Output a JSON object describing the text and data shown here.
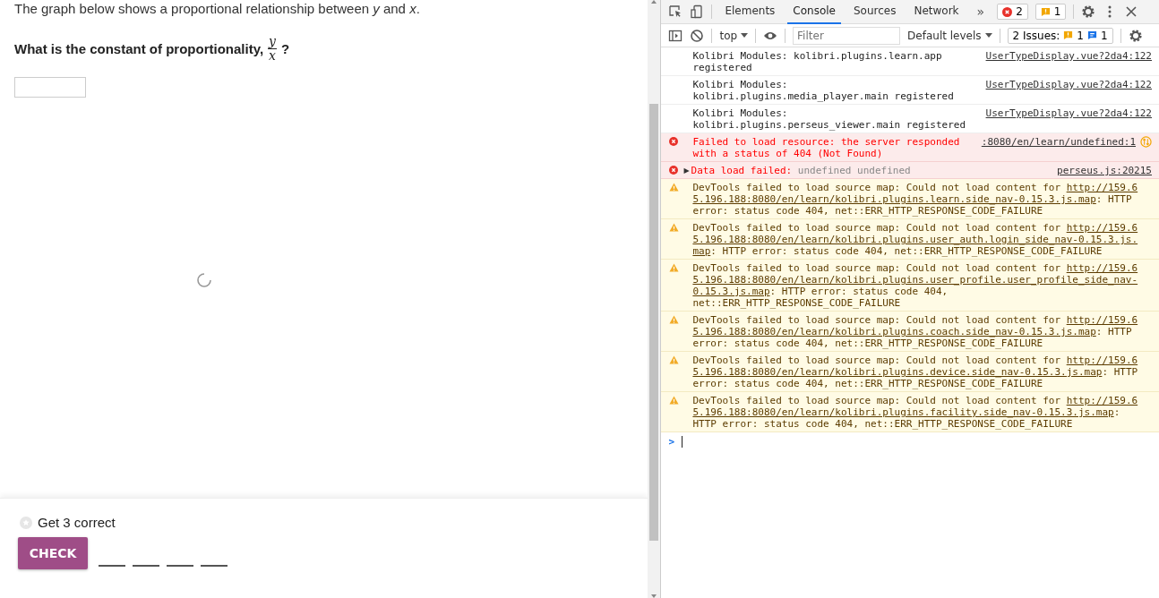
{
  "exercise": {
    "prompt": "The graph below shows a proportional relationship between *y* and *x*.",
    "question": {
      "text": "What is the constant of proportionality,",
      "numerator": "y",
      "denominator": "x",
      "end": "?"
    },
    "goal": "Get 3 correct",
    "check_button": "CHECK",
    "attempt_slots": [
      {
        "answered": false
      },
      {
        "answered": false
      },
      {
        "answered": false
      },
      {
        "answered": false
      }
    ]
  },
  "devtools": {
    "tabs": [
      {
        "label": "Elements",
        "selected": false
      },
      {
        "label": "Console",
        "selected": true
      },
      {
        "label": "Sources",
        "selected": false
      },
      {
        "label": "Network",
        "selected": false
      }
    ],
    "more_tabs": "»",
    "error_count": "2",
    "warning_count": "1",
    "context": "top",
    "filter": {
      "placeholder": "Filter"
    },
    "levels": "Default levels",
    "issues": {
      "label": "2 Issues:",
      "warnings": "1",
      "infos": "1"
    },
    "messages": [
      {
        "kind": "info",
        "text": "Kolibri Modules: kolibri.plugins.learn.app registered",
        "source": "UserTypeDisplay.vue?2da4:122",
        "network_icon": false
      },
      {
        "kind": "info",
        "text": "Kolibri Modules: kolibri.plugins.media_player.main registered",
        "source": "UserTypeDisplay.vue?2da4:122",
        "network_icon": false
      },
      {
        "kind": "info",
        "text": "Kolibri Modules: kolibri.plugins.perseus_viewer.main registered",
        "source": "UserTypeDisplay.vue?2da4:122",
        "network_icon": false
      },
      {
        "kind": "error",
        "text": "Failed to load resource: the server responded with a status of 404 (Not Found)",
        "source": ":8080/en/learn/undefined:1",
        "network_icon": true
      },
      {
        "kind": "error",
        "toggle": "▶",
        "text": "Data load failed: ",
        "detail": "undefined undefined",
        "source": "perseus.js:20215",
        "network_icon": false
      },
      {
        "kind": "warning",
        "text": "DevTools failed to load source map: Could not load content for ",
        "link": "http://159.65.196.188:8080/en/learn/kolibri.plugins.learn.side_nav-0.15.3.js.map",
        "detail": ": HTTP error: status code 404, net::ERR_HTTP_RESPONSE_CODE_FAILURE",
        "network_icon": false
      },
      {
        "kind": "warning",
        "text": "DevTools failed to load source map: Could not load content for ",
        "link": "http://159.65.196.188:8080/en/learn/kolibri.plugins.user_auth.login_side_nav-0.15.3.js.map",
        "detail": ": HTTP error: status code 404, net::ERR_HTTP_RESPONSE_CODE_FAILURE",
        "network_icon": false
      },
      {
        "kind": "warning",
        "text": "DevTools failed to load source map: Could not load content for ",
        "link": "http://159.65.196.188:8080/en/learn/kolibri.plugins.user_profile.user_profile_side_nav-0.15.3.js.map",
        "detail": ": HTTP error: status code 404, net::ERR_HTTP_RESPONSE_CODE_FAILURE",
        "network_icon": false
      },
      {
        "kind": "warning",
        "text": "DevTools failed to load source map: Could not load content for ",
        "link": "http://159.65.196.188:8080/en/learn/kolibri.plugins.coach.side_nav-0.15.3.js.map",
        "detail": ": HTTP error: status code 404, net::ERR_HTTP_RESPONSE_CODE_FAILURE",
        "network_icon": false
      },
      {
        "kind": "warning",
        "text": "DevTools failed to load source map: Could not load content for ",
        "link": "http://159.65.196.188:8080/en/learn/kolibri.plugins.device.side_nav-0.15.3.js.map",
        "detail": ": HTTP error: status code 404, net::ERR_HTTP_RESPONSE_CODE_FAILURE",
        "network_icon": false
      },
      {
        "kind": "warning",
        "text": "DevTools failed to load source map: Could not load content for ",
        "link": "http://159.65.196.188:8080/en/learn/kolibri.plugins.facility.side_nav-0.15.3.js.map",
        "detail": ": HTTP error: status code 404, net::ERR_HTTP_RESPONSE_CODE_FAILURE",
        "network_icon": false
      }
    ],
    "prompt": ">"
  }
}
